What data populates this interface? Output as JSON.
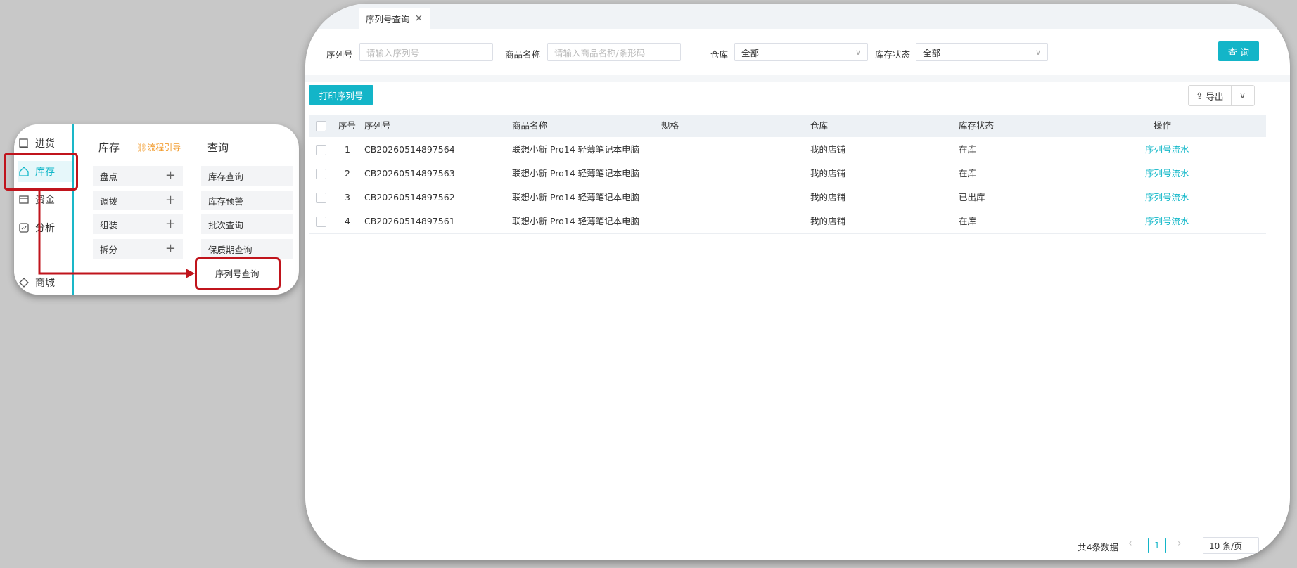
{
  "tab": {
    "title": "序列号查询",
    "close": "×"
  },
  "filters": {
    "serial_label": "序列号",
    "serial_placeholder": "请输入序列号",
    "product_label": "商品名称",
    "product_placeholder": "请输入商品名称/条形码",
    "warehouse_label": "仓库",
    "warehouse_value": "全部",
    "status_label": "库存状态",
    "status_value": "全部",
    "query_button": "查 询"
  },
  "toolbar": {
    "print_button": "打印序列号",
    "export_button": "导出"
  },
  "table": {
    "headers": {
      "index": "序号",
      "serial": "序列号",
      "product": "商品名称",
      "spec": "规格",
      "warehouse": "仓库",
      "status": "库存状态",
      "action": "操作"
    },
    "rows": [
      {
        "index": "1",
        "serial": "CB20260514897564",
        "product": "联想小新 Pro14 轻薄笔记本电脑",
        "spec": "",
        "warehouse": "我的店铺",
        "status": "在库",
        "action": "序列号流水"
      },
      {
        "index": "2",
        "serial": "CB20260514897563",
        "product": "联想小新 Pro14 轻薄笔记本电脑",
        "spec": "",
        "warehouse": "我的店铺",
        "status": "在库",
        "action": "序列号流水"
      },
      {
        "index": "3",
        "serial": "CB20260514897562",
        "product": "联想小新 Pro14 轻薄笔记本电脑",
        "spec": "",
        "warehouse": "我的店铺",
        "status": "已出库",
        "action": "序列号流水"
      },
      {
        "index": "4",
        "serial": "CB20260514897561",
        "product": "联想小新 Pro14 轻薄笔记本电脑",
        "spec": "",
        "warehouse": "我的店铺",
        "status": "在库",
        "action": "序列号流水"
      }
    ]
  },
  "pagination": {
    "total_text": "共4条数据",
    "current_page": "1",
    "page_size": "10 条/页"
  },
  "callout": {
    "nav": [
      {
        "label": "进货",
        "icon": "purchase-icon"
      },
      {
        "label": "库存",
        "icon": "home-icon"
      },
      {
        "label": "资金",
        "icon": "wallet-icon"
      },
      {
        "label": "分析",
        "icon": "chart-icon"
      },
      {
        "label": "商城",
        "icon": "store-icon"
      }
    ],
    "inventory_title": "库存",
    "guide_label": "流程引导",
    "inventory_items": [
      "盘点",
      "调拨",
      "组装",
      "拆分"
    ],
    "query_title": "查询",
    "query_items": [
      "库存查询",
      "库存预警",
      "批次查询",
      "保质期查询",
      "序列号查询"
    ]
  },
  "colors": {
    "accent": "#13b5c8",
    "highlight": "#c0141c",
    "guide": "#f29b2c"
  }
}
